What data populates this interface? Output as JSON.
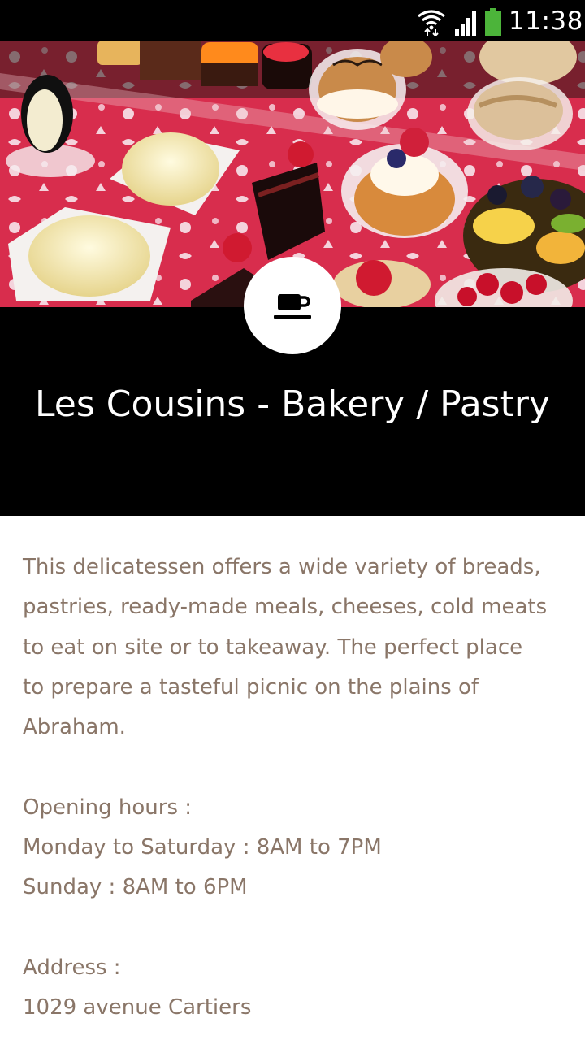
{
  "status_bar": {
    "time": "11:38",
    "icons": [
      "wifi-icon",
      "signal-icon",
      "battery-icon"
    ],
    "battery_color": "#4cb43a"
  },
  "header": {
    "image_subject": "pastry display",
    "category_icon": "coffee-cup-icon",
    "title": "Les Cousins - Bakery / Pastry"
  },
  "content": {
    "description_lines": [
      "This delicatessen offers a wide variety of breads,",
      "pastries, ready-made meals, cheeses, cold meats",
      "to eat on site or to takeaway. The perfect place",
      "to prepare a tasteful picnic on the plains of",
      "Abraham."
    ],
    "hours_heading": "Opening hours :",
    "hours": [
      "Monday to Saturday : 8AM to 7PM",
      "Sunday : 8AM to 6PM"
    ],
    "address_heading": "Address :",
    "address_line": "1029 avenue Cartiers"
  },
  "colors": {
    "text": "#8a7668",
    "band": "#000000",
    "tablecloth": "#d82d4d"
  }
}
